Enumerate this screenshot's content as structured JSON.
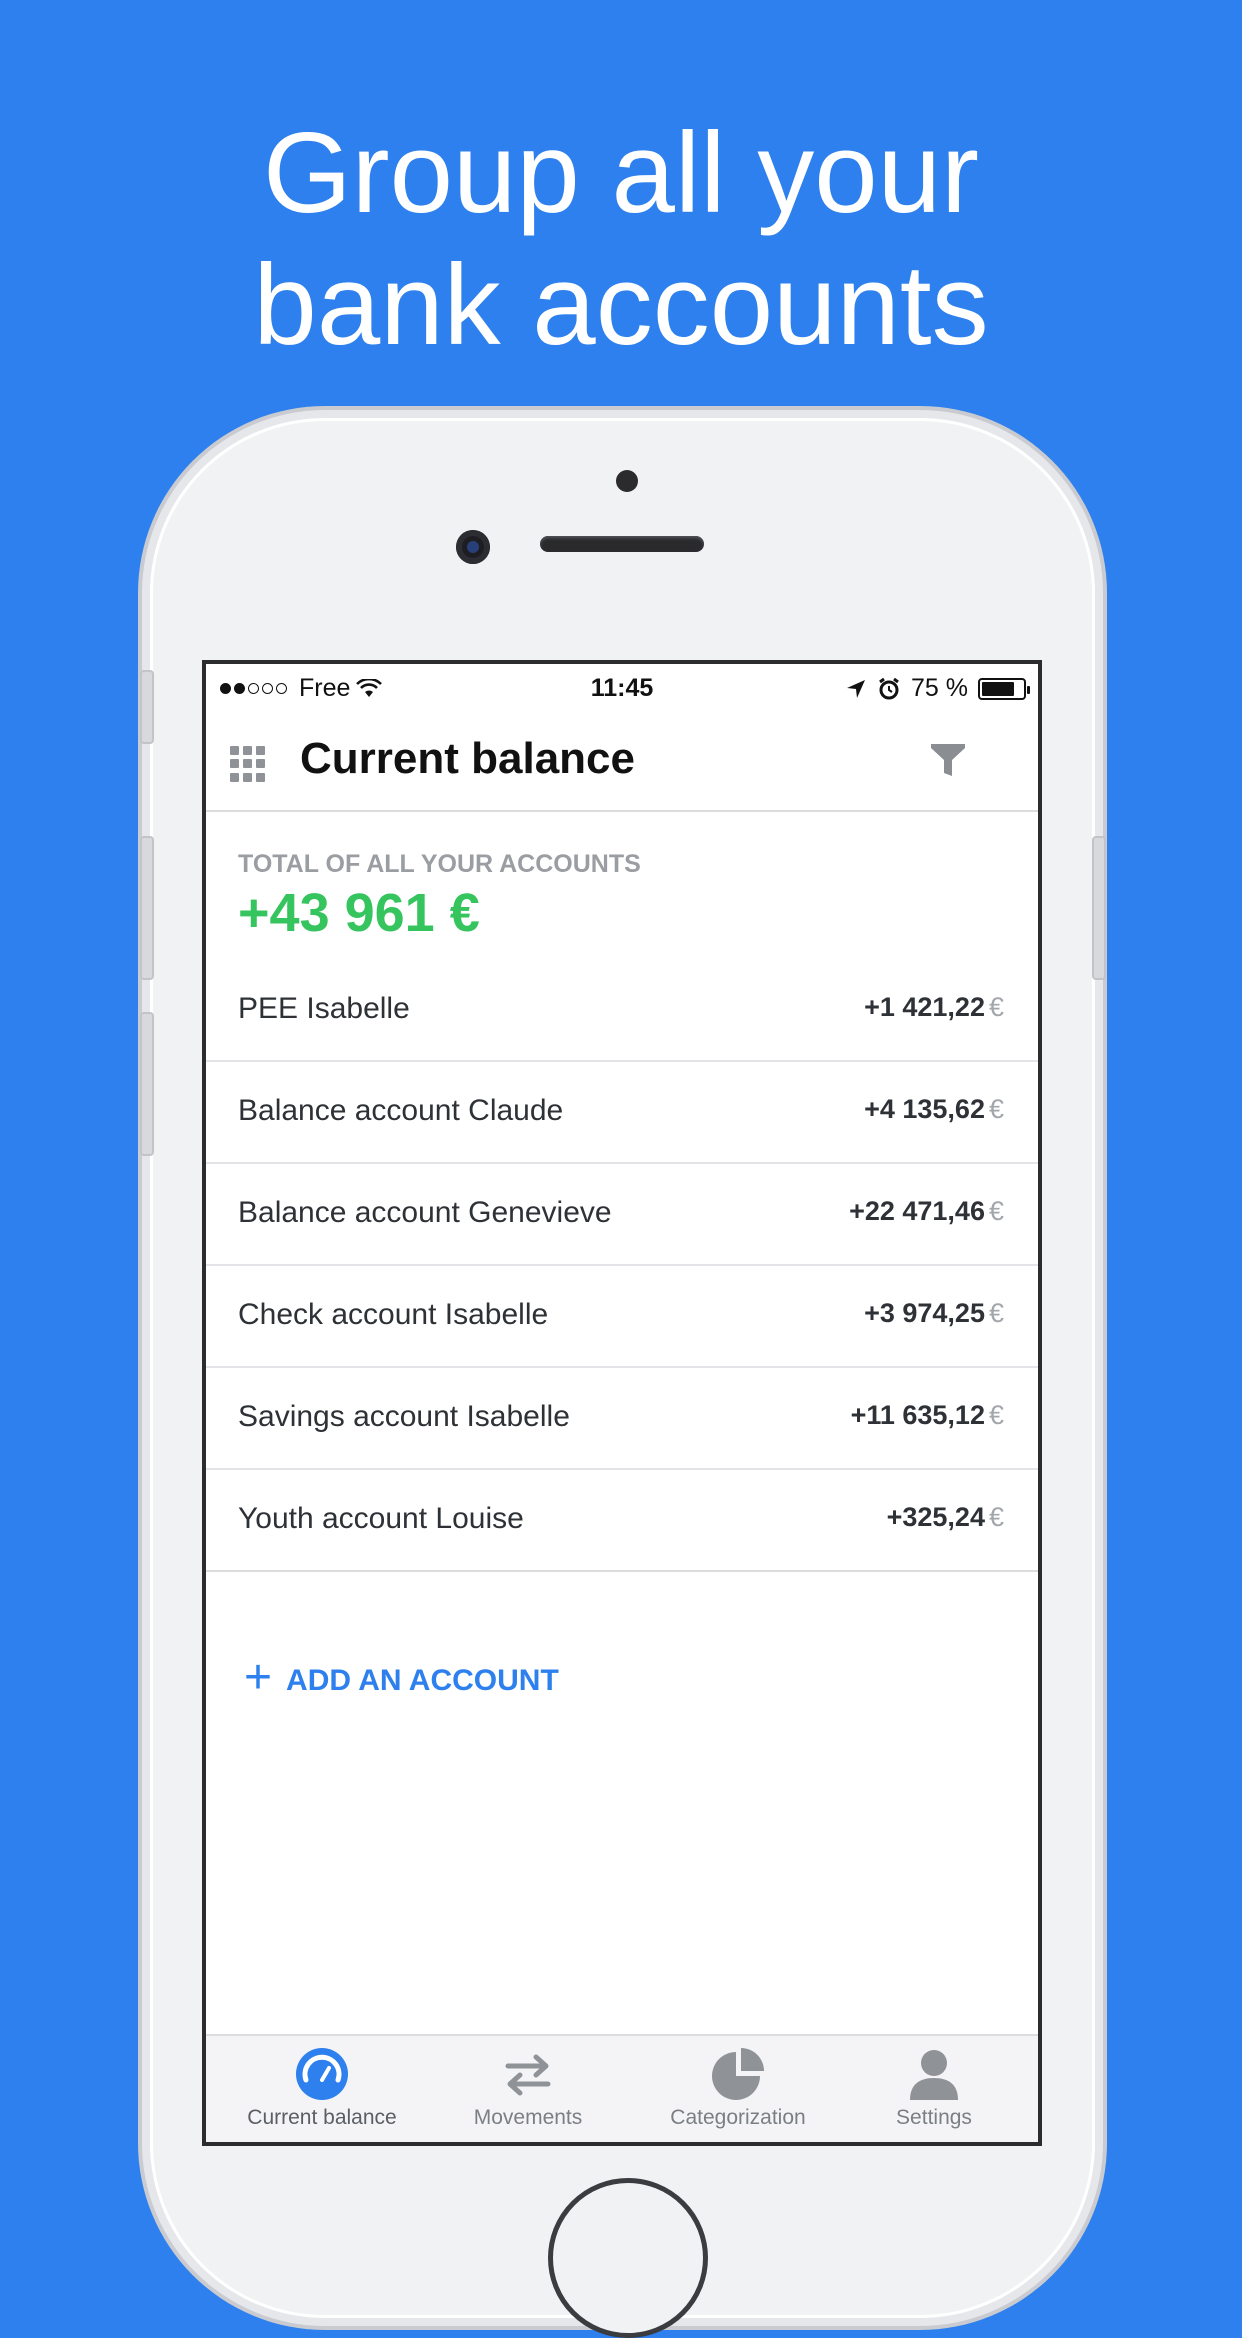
{
  "headline": {
    "line1": "Group all your",
    "line2": "bank accounts"
  },
  "status_bar": {
    "carrier": "Free",
    "time": "11:45",
    "battery": "75 %"
  },
  "navbar": {
    "title": "Current balance"
  },
  "summary": {
    "label": "TOTAL OF ALL YOUR ACCOUNTS",
    "value": "+43 961 €"
  },
  "accounts": [
    {
      "name": "PEE Isabelle",
      "amount": "+1 421,22",
      "currency": "€"
    },
    {
      "name": "Balance account Claude",
      "amount": "+4 135,62",
      "currency": "€"
    },
    {
      "name": "Balance account Genevieve",
      "amount": "+22 471,46",
      "currency": "€"
    },
    {
      "name": "Check account Isabelle",
      "amount": "+3 974,25",
      "currency": "€"
    },
    {
      "name": "Savings account Isabelle",
      "amount": "+11 635,12",
      "currency": "€"
    },
    {
      "name": "Youth account Louise",
      "amount": "+325,24",
      "currency": "€"
    }
  ],
  "add_account": {
    "plus": "+",
    "label": "ADD AN ACCOUNT"
  },
  "tabs": [
    {
      "label": "Current balance",
      "icon": "gauge-icon",
      "active": true
    },
    {
      "label": "Movements",
      "icon": "transfer-arrows-icon",
      "active": false
    },
    {
      "label": "Categorization",
      "icon": "pie-chart-icon",
      "active": false
    },
    {
      "label": "Settings",
      "icon": "person-icon",
      "active": false
    }
  ],
  "colors": {
    "background": "#2d80ed",
    "accent_blue": "#2d80ed",
    "positive_green": "#35c45d",
    "muted_gray": "#9a9da1"
  }
}
